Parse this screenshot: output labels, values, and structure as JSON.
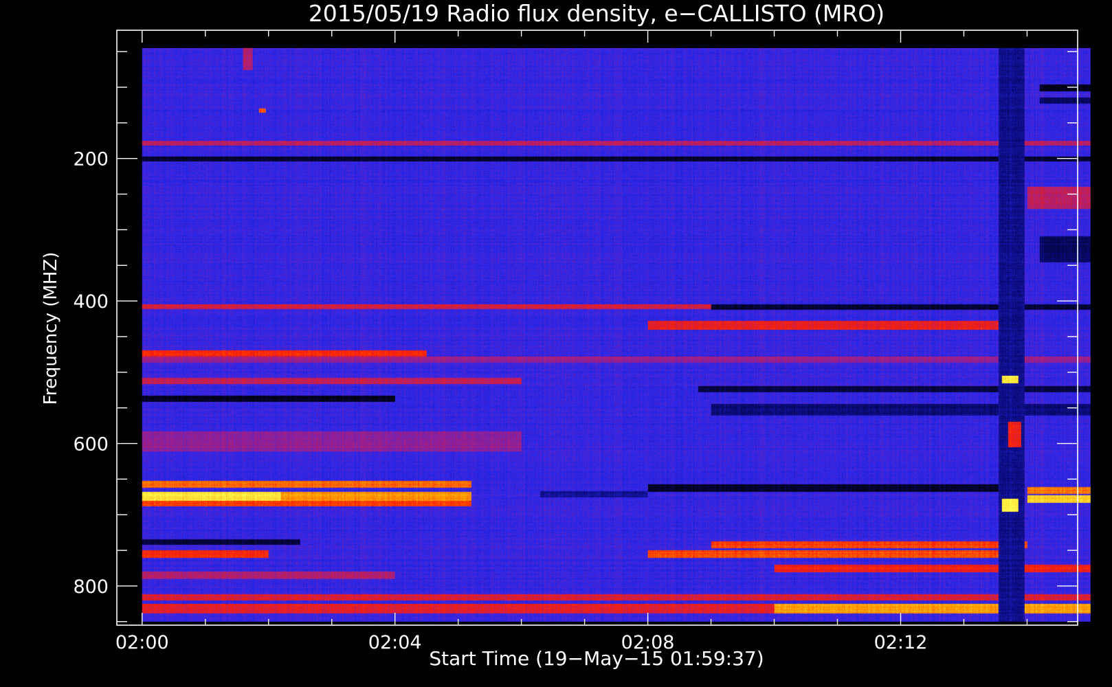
{
  "chart_data": {
    "type": "heatmap",
    "title": "2015/05/19  Radio flux density, e−CALLISTO (MRO)",
    "xlabel": "Start Time (19−May−15 01:59:37)",
    "ylabel": "Frequency (MHZ)",
    "x_axis": {
      "unit": "minutes after 02:00",
      "range": [
        -0.4,
        14.8
      ],
      "data_range": [
        0.0,
        15.0
      ],
      "major_ticks": [
        0,
        4,
        8,
        12
      ],
      "tick_labels": [
        "02:00",
        "02:04",
        "02:08",
        "02:12"
      ],
      "minor_tick_step": 1
    },
    "y_axis": {
      "unit": "MHz",
      "inverted": true,
      "range": [
        20,
        855
      ],
      "data_range": [
        45,
        850
      ],
      "major_ticks": [
        200,
        400,
        600,
        800
      ],
      "tick_labels": [
        "200",
        "400",
        "600",
        "800"
      ],
      "minor_tick_step": 50
    },
    "colormap": [
      "#000000",
      "#0a0a78",
      "#2828f0",
      "#9b1f8f",
      "#ff1f00",
      "#ffa000",
      "#ffff50"
    ],
    "background_level": 2.1,
    "features": [
      {
        "f": [
          653,
          662
        ],
        "t": [
          0.0,
          5.2
        ],
        "level": 4.6
      },
      {
        "f": [
          668,
          680
        ],
        "t": [
          0.0,
          2.2
        ],
        "level": 5.7
      },
      {
        "f": [
          668,
          680
        ],
        "t": [
          2.2,
          5.2
        ],
        "level": 4.9
      },
      {
        "f": [
          681,
          688
        ],
        "t": [
          0.0,
          5.2
        ],
        "level": 4.2
      },
      {
        "f": [
          662,
          670
        ],
        "t": [
          14.0,
          15.0
        ],
        "level": 4.7
      },
      {
        "f": [
          673,
          683
        ],
        "t": [
          14.0,
          15.0
        ],
        "level": 5.5
      },
      {
        "f": [
          658,
          667
        ],
        "t": [
          8.0,
          13.6
        ],
        "level": 0.4
      },
      {
        "f": [
          667,
          675
        ],
        "t": [
          6.3,
          8.0
        ],
        "level": 1.2
      },
      {
        "f": [
          405,
          411
        ],
        "t": [
          0.0,
          9.0
        ],
        "level": 3.6
      },
      {
        "f": [
          405,
          412
        ],
        "t": [
          9.0,
          15.0
        ],
        "level": 0.5
      },
      {
        "f": [
          428,
          440
        ],
        "t": [
          8.0,
          13.8
        ],
        "level": 3.8
      },
      {
        "f": [
          470,
          478
        ],
        "t": [
          0.0,
          4.5
        ],
        "level": 4.0
      },
      {
        "f": [
          478,
          486
        ],
        "t": [
          0.0,
          15.0
        ],
        "level": 3.0
      },
      {
        "f": [
          508,
          516
        ],
        "t": [
          0.0,
          6.0
        ],
        "level": 3.4
      },
      {
        "f": [
          520,
          528
        ],
        "t": [
          8.8,
          15.0
        ],
        "level": 0.6
      },
      {
        "f": [
          533,
          541
        ],
        "t": [
          0.0,
          4.0
        ],
        "level": 0.3
      },
      {
        "f": [
          545,
          560
        ],
        "t": [
          9.0,
          15.0
        ],
        "level": 1.0
      },
      {
        "f": [
          583,
          610
        ],
        "t": [
          0.0,
          6.0
        ],
        "level": 2.9
      },
      {
        "f": [
          198,
          204
        ],
        "t": [
          0.0,
          15.0
        ],
        "level": 0.4
      },
      {
        "f": [
          176,
          181
        ],
        "t": [
          0.0,
          15.0
        ],
        "level": 3.3
      },
      {
        "f": [
          735,
          742
        ],
        "t": [
          0.0,
          2.5
        ],
        "level": 0.5
      },
      {
        "f": [
          738,
          746
        ],
        "t": [
          9.0,
          14.0
        ],
        "level": 4.2
      },
      {
        "f": [
          750,
          760
        ],
        "t": [
          0.0,
          2.0
        ],
        "level": 4.0
      },
      {
        "f": [
          750,
          760
        ],
        "t": [
          8.0,
          13.8
        ],
        "level": 4.3
      },
      {
        "f": [
          770,
          780
        ],
        "t": [
          10.0,
          15.0
        ],
        "level": 3.9
      },
      {
        "f": [
          780,
          790
        ],
        "t": [
          0.0,
          4.0
        ],
        "level": 3.2
      },
      {
        "f": [
          812,
          820
        ],
        "t": [
          0.0,
          15.0
        ],
        "level": 3.6
      },
      {
        "f": [
          825,
          838
        ],
        "t": [
          10.0,
          15.0
        ],
        "level": 5.0
      },
      {
        "f": [
          825,
          838
        ],
        "t": [
          0.0,
          10.0
        ],
        "level": 3.7
      },
      {
        "f": [
          97,
          105
        ],
        "t": [
          14.2,
          15.0
        ],
        "level": 0.2
      },
      {
        "f": [
          115,
          123
        ],
        "t": [
          14.2,
          15.0
        ],
        "level": 0.8
      },
      {
        "f": [
          240,
          270
        ],
        "t": [
          14.0,
          15.0
        ],
        "level": 3.3
      },
      {
        "f": [
          310,
          345
        ],
        "t": [
          14.2,
          15.0
        ],
        "level": 0.8
      },
      {
        "f": [
          45,
          850
        ],
        "t": [
          13.55,
          13.95
        ],
        "level": 1.2
      },
      {
        "f": [
          505,
          515
        ],
        "t": [
          13.6,
          13.85
        ],
        "level": 5.8
      },
      {
        "f": [
          678,
          695
        ],
        "t": [
          13.6,
          13.85
        ],
        "level": 5.9
      },
      {
        "f": [
          570,
          605
        ],
        "t": [
          13.7,
          13.9
        ],
        "level": 3.9
      },
      {
        "f": [
          45,
          75
        ],
        "t": [
          1.6,
          1.75
        ],
        "level": 3.2
      },
      {
        "f": [
          130,
          135
        ],
        "t": [
          1.85,
          1.95
        ],
        "level": 4.5
      }
    ]
  }
}
